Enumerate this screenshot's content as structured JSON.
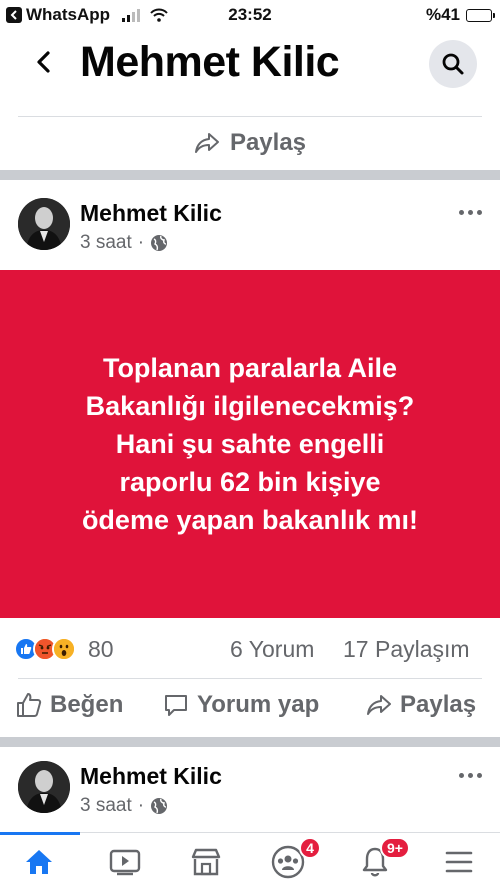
{
  "status_bar": {
    "back_app": "WhatsApp",
    "time": "23:52",
    "battery": "%41",
    "battery_level": 0.41
  },
  "header": {
    "title": "Mehmet Kilic",
    "back_icon": "chevron-left-icon",
    "search_icon": "search-icon"
  },
  "prev_post": {
    "share_label": "Paylaş"
  },
  "post": {
    "author": "Mehmet Kilic",
    "time": "3 saat",
    "separator": "·",
    "privacy_icon": "globe-icon",
    "image_text": [
      "Toplanan paralarla Aile",
      "Bakanlığı ilgilenecekmiş?",
      "Hani şu sahte engelli",
      "raporlu 62 bin kişiye",
      "ödeme yapan bakanlık mı!"
    ],
    "image_bg": "#e0133a",
    "reaction_icons": [
      "like-reaction-icon",
      "angry-reaction-icon",
      "wow-reaction-icon"
    ],
    "reaction_count": "80",
    "comments": "6 Yorum",
    "shares": "17 Paylaşım",
    "actions": {
      "like": "Beğen",
      "comment": "Yorum yap",
      "share": "Paylaş"
    }
  },
  "next_post": {
    "author": "Mehmet Kilic",
    "time": "3 saat",
    "separator": "·"
  },
  "nav": {
    "items": [
      "home-icon",
      "video-icon",
      "marketplace-icon",
      "groups-icon",
      "notifications-icon",
      "menu-icon"
    ],
    "groups_badge": "4",
    "notifications_badge": "9+",
    "accent": "#1877f2"
  }
}
